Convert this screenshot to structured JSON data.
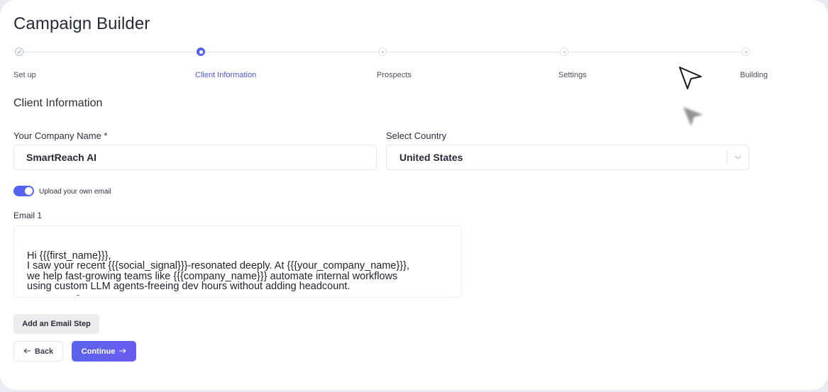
{
  "page": {
    "title": "Campaign Builder"
  },
  "stepper": {
    "steps": [
      {
        "label": "Set up",
        "state": "done"
      },
      {
        "label": "Client Information",
        "state": "active"
      },
      {
        "label": "Prospects",
        "state": "todo"
      },
      {
        "label": "Settings",
        "state": "todo"
      },
      {
        "label": "Building",
        "state": "todo"
      }
    ]
  },
  "section": {
    "title": "Client Information"
  },
  "form": {
    "company_name_label": "Your Company Name *",
    "company_name_value": "SmartReach AI",
    "country_label": "Select Country",
    "country_value": "United States",
    "upload_toggle_label": "Upload your own email",
    "upload_toggle_on": true,
    "email_label": "Email 1",
    "email_body": "Hi {{{first_name}}},\nI saw your recent {{{social_signal}}}-resonated deeply. At {{{your_company_name}}},\nwe help fast-growing teams like {{{company_name}}} automate internal workflows\nusing custom LLM agents-freeing dev hours without adding headcount."
  },
  "actions": {
    "add_email_step": "Add an Email Step",
    "back": "Back",
    "continue": "Continue"
  },
  "colors": {
    "accent": "#5663f0",
    "active_step_text": "#4b56d8",
    "background": "#ffffff"
  },
  "icons": {
    "step_done": "check-circle-icon",
    "country_dropdown": "chevron-down-icon",
    "back": "arrow-left-icon",
    "continue": "arrow-right-icon",
    "cursor": "mouse-pointer-icon"
  }
}
